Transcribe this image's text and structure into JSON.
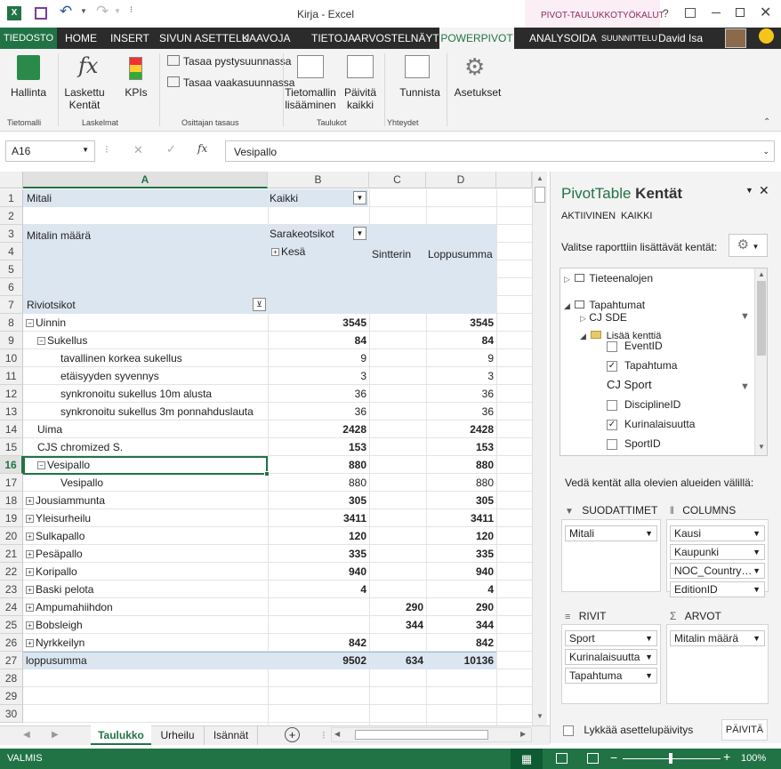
{
  "window": {
    "title": "Kirja - Excel",
    "context_tab_group": "PIVOT-TAULUKKOTYÖKALUT",
    "help": "?",
    "user": "David Isa"
  },
  "tabs": [
    "TIEDOSTO",
    "HOME",
    "INSERT",
    "SIVUN ASETTELU",
    "KAAVOJA",
    "TIETOJA",
    "ARVOSTELNÄYTÄ",
    "POWERPIVOT",
    "ANALYSOIDA",
    "SUUNNITTELU"
  ],
  "ribbon": {
    "manage": "Hallinta",
    "calc_fields": "Laskettu Kentät",
    "kpis": "KPIs",
    "align_v": "Tasaa pystysuunnassa",
    "align_h": "Tasaa vaakasuunnassa",
    "add_model": "Tietomallin lisääminen",
    "update_all": "Päivitä kaikki",
    "detect": "Tunnista",
    "settings": "Asetukset",
    "groups": [
      "Tietomalli",
      "Laskelmat",
      "Osittajan tasaus",
      "Taulukot",
      "Yhteydet"
    ]
  },
  "formula": {
    "namebox": "A16",
    "fx": "fx",
    "value": "Vesipallo"
  },
  "columns": [
    "A",
    "B",
    "C",
    "D"
  ],
  "rows": [
    "1",
    "2",
    "3",
    "4",
    "5",
    "6",
    "7",
    "8",
    "9",
    "10",
    "11",
    "12",
    "13",
    "14",
    "15",
    "16",
    "17",
    "18",
    "19",
    "20",
    "21",
    "22",
    "23",
    "24",
    "25",
    "26",
    "27",
    "28",
    "29",
    "30"
  ],
  "pivot": {
    "filter_label": "Mitali",
    "filter_value": "Kaikki",
    "value_label": "Mitalin määrä",
    "col_labels": "Sarakeotsikot",
    "col_summer": "Kesä",
    "col_winter": "Sintterin",
    "col_total": "Loppusumma",
    "row_labels": "Riviotsikot",
    "data": [
      {
        "label": "Uinnin",
        "indent": 0,
        "pm": "−",
        "b": "3545",
        "c": "",
        "d": "3545",
        "bold": true
      },
      {
        "label": "Sukellus",
        "indent": 1,
        "pm": "−",
        "b": "84",
        "c": "",
        "d": "84",
        "bold": true
      },
      {
        "label": "tavallinen korkea sukellus",
        "indent": 2,
        "pm": "",
        "b": "9",
        "c": "",
        "d": "9",
        "bold": false
      },
      {
        "label": "etäisyyden syvennys",
        "indent": 2,
        "pm": "",
        "b": "3",
        "c": "",
        "d": "3",
        "bold": false
      },
      {
        "label": "synkronoitu sukellus 10m alusta",
        "indent": 2,
        "pm": "",
        "b": "36",
        "c": "",
        "d": "36",
        "bold": false
      },
      {
        "label": "synkronoitu sukellus 3m ponnahduslauta",
        "indent": 2,
        "pm": "",
        "b": "36",
        "c": "",
        "d": "36",
        "bold": false
      },
      {
        "label": "Uima",
        "indent": 1,
        "pm": "",
        "b": "2428",
        "c": "",
        "d": "2428",
        "bold": true
      },
      {
        "label": "CJS chromized S.",
        "indent": 1,
        "pm": "",
        "b": "153",
        "c": "",
        "d": "153",
        "bold": true
      },
      {
        "label": "Vesipallo",
        "indent": 1,
        "pm": "−",
        "b": "880",
        "c": "",
        "d": "880",
        "bold": true
      },
      {
        "label": "Vesipallo",
        "indent": 2,
        "pm": "",
        "b": "880",
        "c": "",
        "d": "880",
        "bold": false
      },
      {
        "label": "Jousiammunta",
        "indent": 0,
        "pm": "+",
        "b": "305",
        "c": "",
        "d": "305",
        "bold": true
      },
      {
        "label": "Yleisurheilu",
        "indent": 0,
        "pm": "+",
        "b": "3411",
        "c": "",
        "d": "3411",
        "bold": true
      },
      {
        "label": "Sulkapallo",
        "indent": 0,
        "pm": "+",
        "b": "120",
        "c": "",
        "d": "120",
        "bold": true
      },
      {
        "label": "Pesäpallo",
        "indent": 0,
        "pm": "+",
        "b": "335",
        "c": "",
        "d": "335",
        "bold": true
      },
      {
        "label": "Koripallo",
        "indent": 0,
        "pm": "+",
        "b": "940",
        "c": "",
        "d": "940",
        "bold": true
      },
      {
        "label": "Baski pelota",
        "indent": 0,
        "pm": "+",
        "b": "4",
        "c": "",
        "d": "4",
        "bold": true
      },
      {
        "label": "Ampumahiihdon",
        "indent": 0,
        "pm": "+",
        "b": "",
        "c": "290",
        "d": "290",
        "bold": true
      },
      {
        "label": "Bobsleigh",
        "indent": 0,
        "pm": "+",
        "b": "",
        "c": "344",
        "d": "344",
        "bold": true
      },
      {
        "label": "Nyrkkeilyn",
        "indent": 0,
        "pm": "+",
        "b": "842",
        "c": "",
        "d": "842",
        "bold": true
      },
      {
        "label": "loppusumma",
        "indent": 0,
        "pm": "",
        "b": "9502",
        "c": "634",
        "d": "10136",
        "bold": true
      }
    ]
  },
  "pane": {
    "title": "PivotTable",
    "title2": "Kentät",
    "tab_active": "AKTIIVINEN",
    "tab_all": "KAIKKI",
    "choose": "Valitse raporttiin lisättävät kentät:",
    "tables": [
      {
        "name": "Tieteenalojen",
        "expanded": false
      },
      {
        "name": "Tapahtumat",
        "expanded": true
      }
    ],
    "field_cjsde": "CJ SDE",
    "add_more": "Lisää kenttiä",
    "fields": [
      {
        "name": "EventID",
        "checked": false
      },
      {
        "name": "Tapahtuma",
        "checked": true
      },
      {
        "name": "CJ Sport",
        "checked": false,
        "heading": true
      },
      {
        "name": "DisciplineID",
        "checked": false
      },
      {
        "name": "Kurinalaisuutta",
        "checked": true
      },
      {
        "name": "SportID",
        "checked": false
      }
    ],
    "drag_hint": "Vedä kentät alla olevien alueiden välillä:",
    "zones": {
      "filters": "SUODATTIMET",
      "columns": "COLUMNS",
      "rows": "RIVIT",
      "values": "ARVOT"
    },
    "filter_items": [
      "Mitali"
    ],
    "column_items": [
      "Kausi",
      "Kaupunki",
      "NOC_Country…",
      "EditionID"
    ],
    "row_items": [
      "Sport",
      "Kurinalaisuutta",
      "Tapahtuma"
    ],
    "value_items": [
      "Mitalin määrä"
    ],
    "defer": "Lykkää asettelupäivitys",
    "update": "PÄIVITÄ"
  },
  "sheets": [
    "Taulukko",
    "Urheilu",
    "Isännät"
  ],
  "status": {
    "mode": "VALMIS",
    "zoom": "100%"
  },
  "colors": {
    "accent": "#217346",
    "pivot_header": "#dce6f1",
    "selected": "#217346"
  }
}
